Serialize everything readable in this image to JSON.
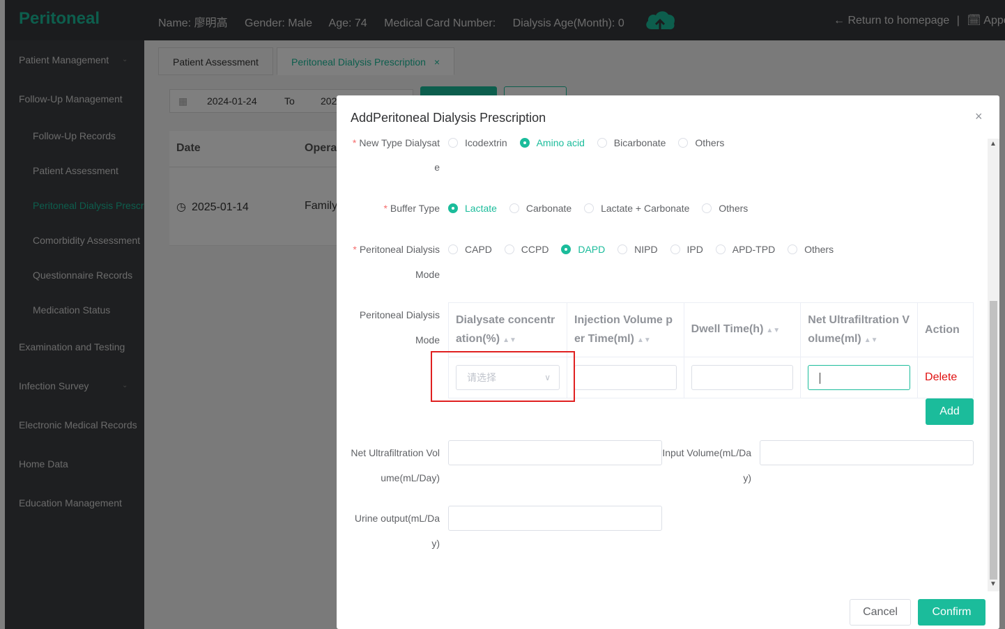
{
  "app": {
    "brand": "Peritoneal"
  },
  "patient": {
    "name": "Name: 廖明高",
    "gender": "Gender: Male",
    "age": "Age: 74",
    "card": "Medical Card Number:",
    "dialysis_age": "Dialysis Age(Month): 0"
  },
  "top_right": {
    "return": "← Return to homepage",
    "separator": "|",
    "appointment": "🗓 Appo"
  },
  "sidebar": {
    "items": [
      {
        "label": "Patient Management"
      },
      {
        "label": "Follow-Up Management"
      },
      {
        "label": "Follow-Up Records"
      },
      {
        "label": "Patient Assessment"
      },
      {
        "label": "Peritoneal Dialysis Prescription"
      },
      {
        "label": "Comorbidity Assessment"
      },
      {
        "label": "Questionnaire Records"
      },
      {
        "label": "Medication Status"
      },
      {
        "label": "Examination and Testing"
      },
      {
        "label": "Infection Survey"
      },
      {
        "label": "Electronic Medical Records"
      },
      {
        "label": "Home Data"
      },
      {
        "label": "Education Management"
      }
    ]
  },
  "tabs": [
    {
      "label": "Patient Assessment"
    },
    {
      "label": "Peritoneal Dialysis Prescription",
      "close": "×"
    }
  ],
  "filter": {
    "start": "2024-01-24",
    "to": "To",
    "end": "202"
  },
  "bg_table": {
    "headers": [
      "Date",
      "Opera"
    ],
    "row": {
      "date": "2025-01-14",
      "op": "Family"
    }
  },
  "modal": {
    "title": "AddPeritoneal Dialysis Prescription",
    "close": "×",
    "new_type": {
      "label_line1": "New Type Dialysat",
      "label_line2": "e",
      "options": [
        "Icodextrin",
        "Amino acid",
        "Bicarbonate",
        "Others"
      ],
      "selected": "Amino acid"
    },
    "buffer": {
      "label": "Buffer Type",
      "options": [
        "Lactate",
        "Carbonate",
        "Lactate + Carbonate",
        "Others"
      ],
      "selected": "Lactate"
    },
    "pd_mode": {
      "label_line1": "Peritoneal Dialysis",
      "label_line2": "Mode",
      "options": [
        "CAPD",
        "CCPD",
        "DAPD",
        "NIPD",
        "IPD",
        "APD-TPD",
        "Others"
      ],
      "selected": "DAPD"
    },
    "pd_table": {
      "label_line1": "Peritoneal Dialysis",
      "label_line2": "Mode",
      "headers": {
        "c1a": "Dialysate concentr",
        "c1b": "ation(%)",
        "c2a": "Injection Volume p",
        "c2b": "er Time(ml)",
        "c3": "Dwell Time(h)",
        "c4a": "Net Ultrafiltration V",
        "c4b": "olume(ml)",
        "c5": "Action"
      },
      "row": {
        "select_placeholder": "请选择",
        "delete": "Delete"
      },
      "add": "Add"
    },
    "net_uf": {
      "label_line1": "Net Ultrafiltration Vol",
      "label_line2": "ume(mL/Day)"
    },
    "input_volume": {
      "label_line1": "Input Volume(mL/Da",
      "label_line2": "y)"
    },
    "urine": {
      "label_line1": "Urine output(mL/Da",
      "label_line2": "y)"
    },
    "cancel": "Cancel",
    "confirm": "Confirm"
  },
  "colors": {
    "accent": "#1bbc9b",
    "danger": "#e01010",
    "topbar": "#37383c",
    "sidebar": "#3d3e42"
  }
}
